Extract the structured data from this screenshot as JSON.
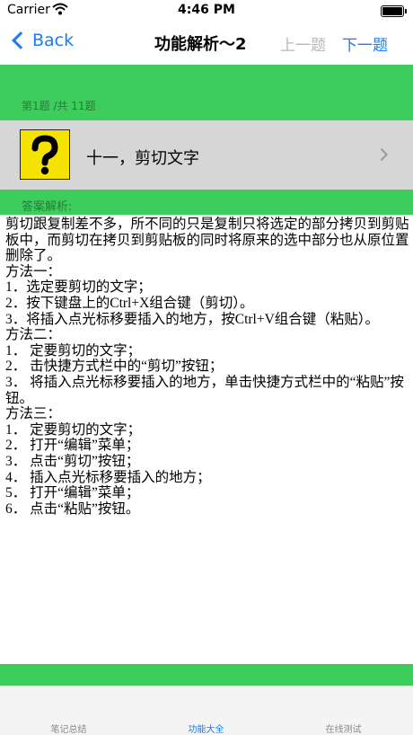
{
  "status_bar": {
    "carrier": "Carrier",
    "time": "4:46 PM",
    "wifi_icon": "wifi-icon",
    "battery_icon": "battery-icon"
  },
  "nav": {
    "back_label": "Back",
    "title": "功能解析～2",
    "prev_label": "上一题",
    "next_label": "下一题"
  },
  "question": {
    "counter": "第1题 /共 11题",
    "title": "十一，剪切文字",
    "icon": "question-mark-icon"
  },
  "answer": {
    "label": "答案解析:",
    "lines": [
      "剪切跟复制差不多，所不同的只是复制只将选定的部分拷贝到剪贴板中，而剪切在拷贝到剪贴板的同时将原来的选中部分也从原位置删除了。",
      "方法一：",
      "1．选定要剪切的文字；",
      "2．按下键盘上的Ctrl+X组合键（剪切）。",
      "3．将插入点光标移要插入的地方，按Ctrl+V组合键（粘贴）。",
      "方法二：",
      "1．  定要剪切的文字；",
      "2．  击快捷方式栏中的“剪切”按钮；",
      "3．  将插入点光标移要插入的地方，单击快捷方式栏中的“粘贴”按钮。",
      "方法三：",
      "1．  定要剪切的文字；",
      "2．  打开“编辑”菜单；",
      "3．  点击“剪切”按钮；",
      "4．  插入点光标移要插入的地方；",
      "5．  打开“编辑”菜单；",
      "6．  点击“粘贴”按钮。"
    ]
  },
  "tabs": [
    {
      "label": "笔记总结",
      "active": false
    },
    {
      "label": "功能大全",
      "active": true
    },
    {
      "label": "在线测试",
      "active": false
    }
  ],
  "colors": {
    "accent": "#1a7cf0",
    "green": "#3dcd5d",
    "row_gray": "#d6d6d6",
    "disabled": "#b8b8b8"
  }
}
